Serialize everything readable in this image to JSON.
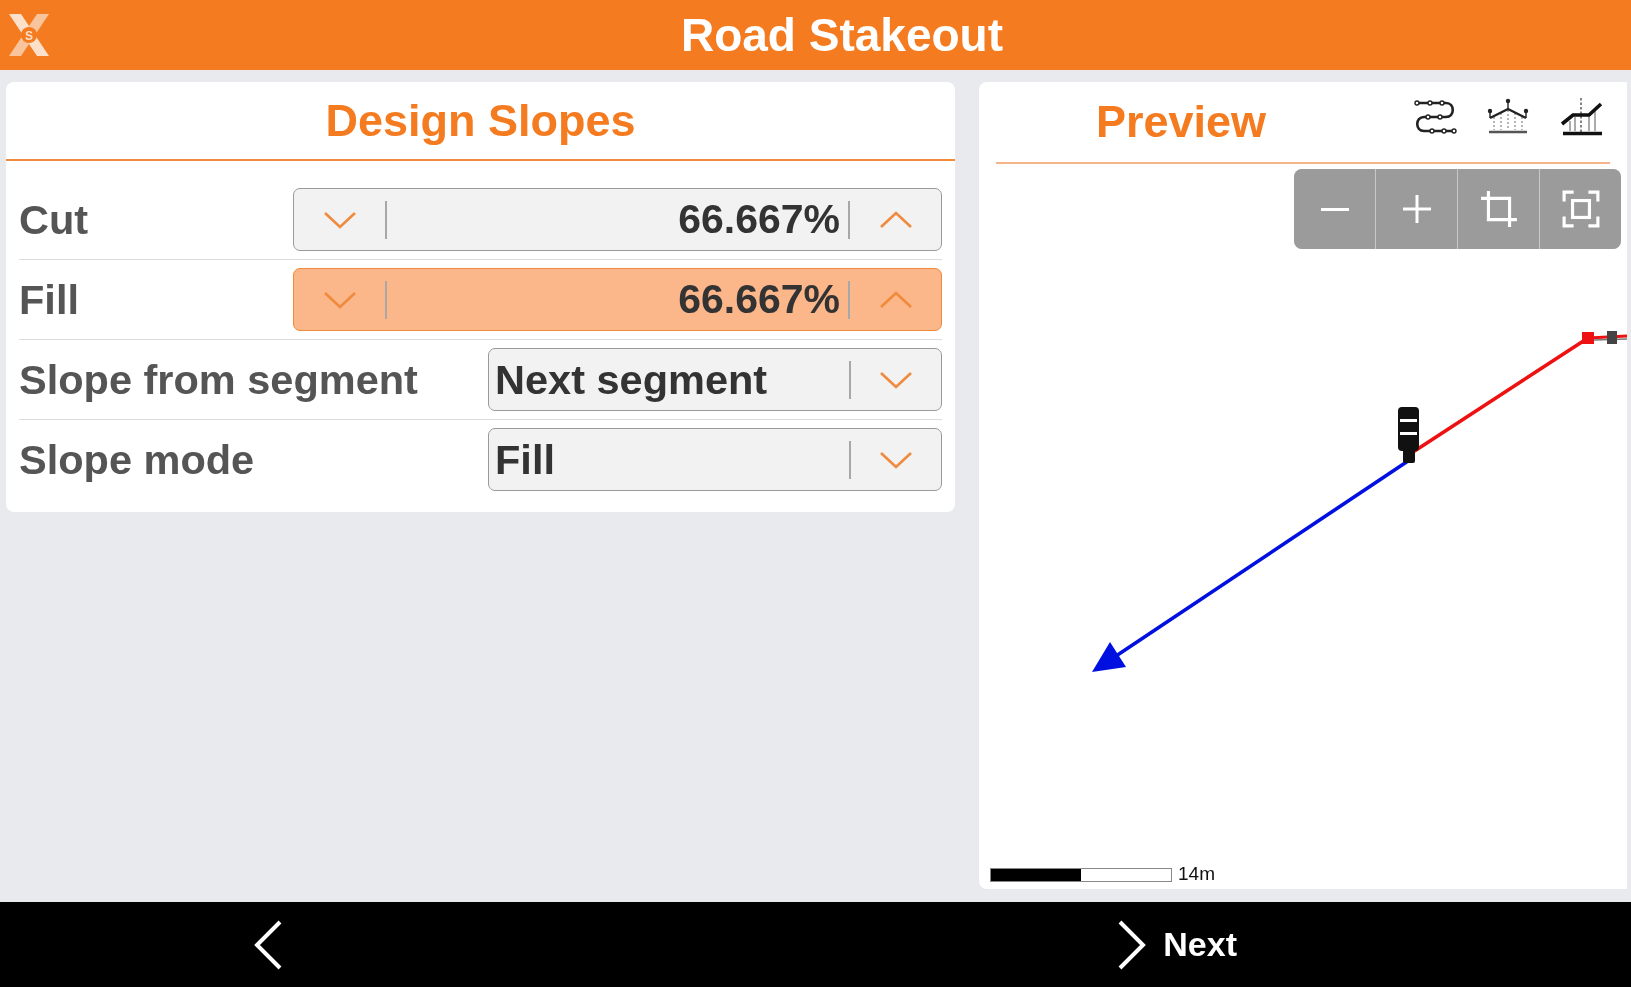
{
  "app_bar": {
    "logo_letter": "S",
    "title": "Road Stakeout"
  },
  "design_panel": {
    "title": "Design Slopes",
    "rows": [
      {
        "kind": "spinner",
        "label": "Cut",
        "value": "66.667%",
        "selected": false
      },
      {
        "kind": "spinner",
        "label": "Fill",
        "value": "66.667%",
        "selected": true
      },
      {
        "kind": "dropdown",
        "label": "Slope from segment",
        "value": "Next segment",
        "selected": false
      },
      {
        "kind": "dropdown",
        "label": "Slope mode",
        "value": "Fill",
        "selected": false
      }
    ]
  },
  "preview_panel": {
    "title": "Preview",
    "scale_label": "14m"
  },
  "bottom_bar": {
    "next_label": "Next"
  }
}
